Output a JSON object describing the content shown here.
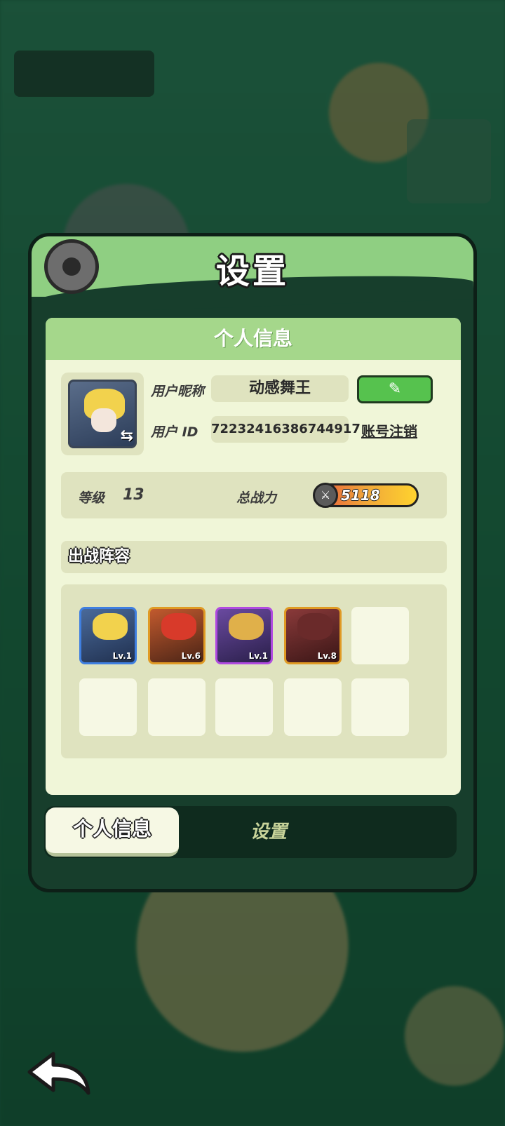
{
  "panel": {
    "title": "设置"
  },
  "profile": {
    "section_title": "个人信息",
    "nickname_label": "用户昵称",
    "nickname": "动感舞王",
    "id_label": "用户 ID",
    "user_id": "72232416386744917",
    "edit_icon": "pencil-edit-icon",
    "cancel_account": "账号注销"
  },
  "stats": {
    "level_label": "等级",
    "level": "13",
    "power_label": "总战力",
    "power": "5118"
  },
  "lineup": {
    "title": "出战阵容",
    "heroes": [
      {
        "level": "Lv.1",
        "rarity_color": "#3f7fe0"
      },
      {
        "level": "Lv.6",
        "rarity_color": "#e09a24"
      },
      {
        "level": "Lv.1",
        "rarity_color": "#b04ae0"
      },
      {
        "level": "Lv.8",
        "rarity_color": "#e09a24"
      }
    ],
    "empty_slots": 6
  },
  "tabs": {
    "profile": "个人信息",
    "settings": "设置"
  },
  "icons": {
    "gear": "gear-icon",
    "swap": "swap-icon",
    "back": "back-arrow-icon",
    "power": "crossed-swords-icon"
  }
}
